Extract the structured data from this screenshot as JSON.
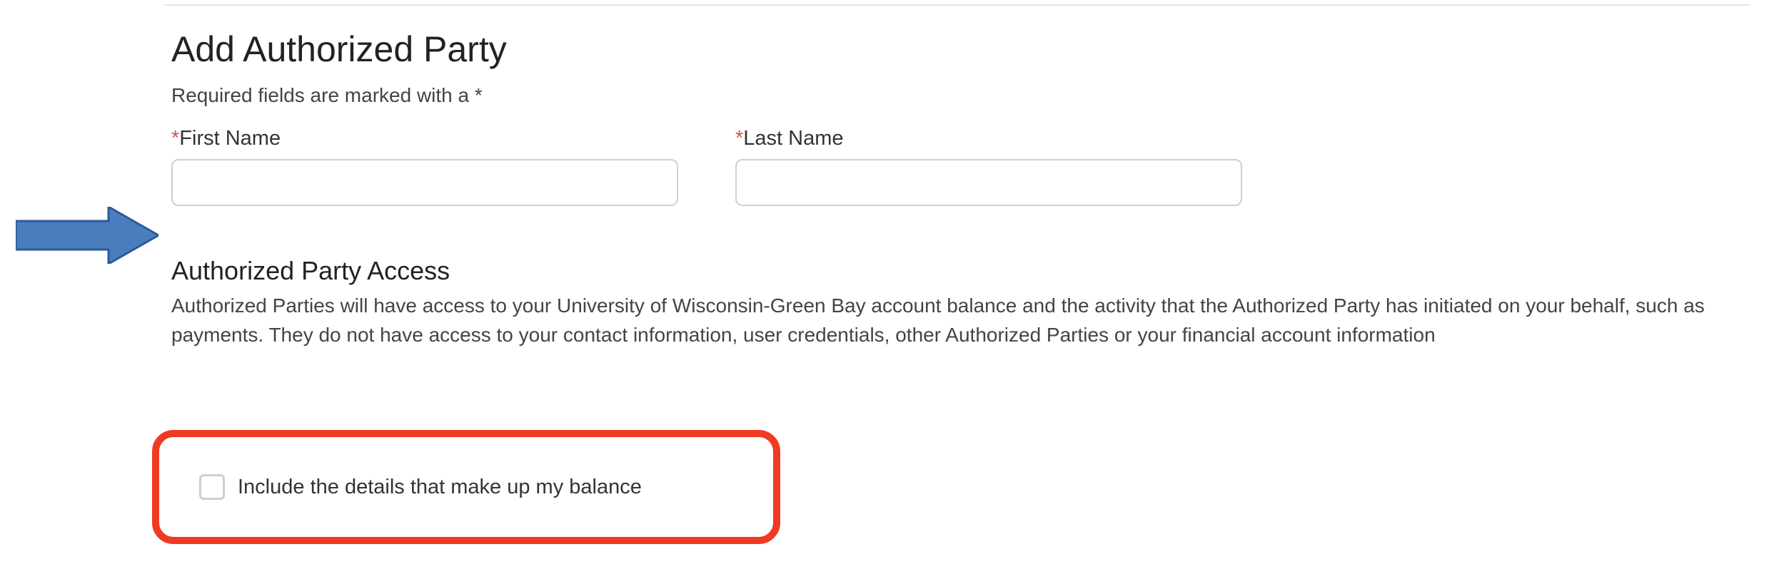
{
  "page": {
    "title": "Add Authorized Party",
    "required_note": "Required fields are marked with a *"
  },
  "fields": {
    "first_name": {
      "label": "First Name",
      "value": ""
    },
    "last_name": {
      "label": "Last Name",
      "value": ""
    }
  },
  "access_section": {
    "title": "Authorized Party Access",
    "description": "Authorized Parties will have access to your University of Wisconsin-Green Bay account balance and the activity that the Authorized Party has initiated on your behalf, such as payments. They do not have access to your contact information, user credentials, other Authorized Parties or your financial account information"
  },
  "checkbox": {
    "label": "Include the details that make up my balance",
    "checked": false
  },
  "annotations": {
    "arrow_color": "#4a7dbd",
    "highlight_color": "#ef3b24"
  }
}
